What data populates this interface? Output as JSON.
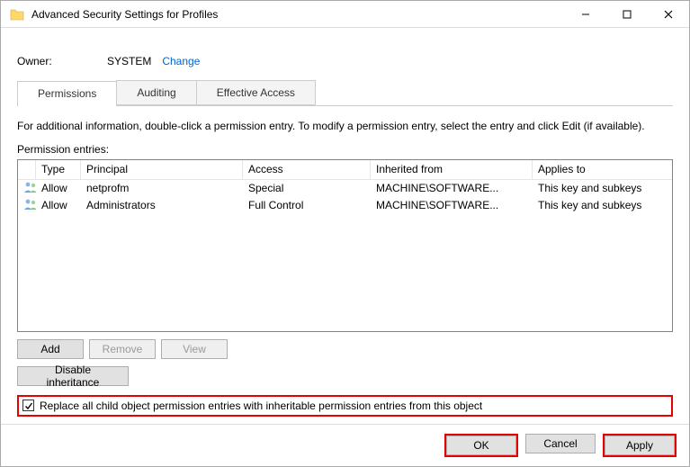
{
  "window": {
    "title": "Advanced Security Settings for Profiles"
  },
  "owner": {
    "label": "Owner:",
    "value": "SYSTEM",
    "change_link": "Change"
  },
  "tabs": {
    "permissions": "Permissions",
    "auditing": "Auditing",
    "effective": "Effective Access"
  },
  "instructions": "For additional information, double-click a permission entry. To modify a permission entry, select the entry and click Edit (if available).",
  "entries_label": "Permission entries:",
  "columns": {
    "type": "Type",
    "principal": "Principal",
    "access": "Access",
    "inherited": "Inherited from",
    "applies": "Applies to"
  },
  "entries": [
    {
      "type": "Allow",
      "principal": "netprofm",
      "access": "Special",
      "inherited": "MACHINE\\SOFTWARE...",
      "applies": "This key and subkeys"
    },
    {
      "type": "Allow",
      "principal": "Administrators",
      "access": "Full Control",
      "inherited": "MACHINE\\SOFTWARE...",
      "applies": "This key and subkeys"
    }
  ],
  "buttons": {
    "add": "Add",
    "remove": "Remove",
    "view": "View",
    "disable_inheritance": "Disable inheritance",
    "ok": "OK",
    "cancel": "Cancel",
    "apply": "Apply"
  },
  "checkbox": {
    "checked": true,
    "label": "Replace all child object permission entries with inheritable permission entries from this object"
  }
}
